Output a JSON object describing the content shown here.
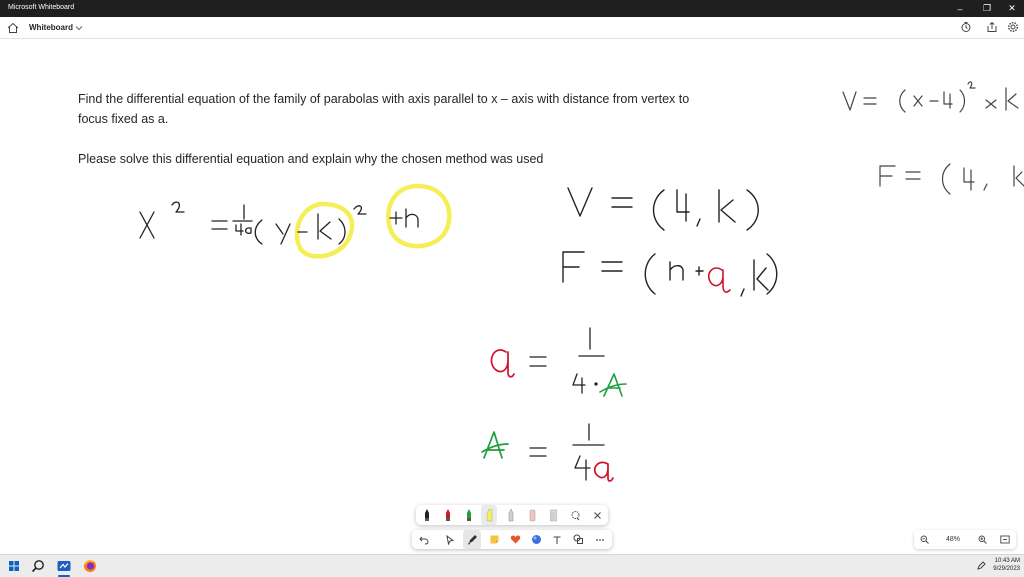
{
  "window": {
    "title": "Microsoft Whiteboard"
  },
  "appbar": {
    "board_title": "Whiteboard"
  },
  "question": {
    "line1": "Find the differential equation of the family of parabolas with axis parallel to x – axis with distance from vertex to",
    "line2": "focus fixed as a.",
    "line3": "Please solve this differential equation and explain why the chosen method was used"
  },
  "zoom": {
    "level": "48%"
  },
  "taskbar": {
    "time": "10:43 AM",
    "date": "9/29/2023"
  },
  "colors": {
    "ink_black": "#222222",
    "ink_red": "#d0112b",
    "ink_green": "#1f9e3c",
    "highlighter": "#f4ef58",
    "titlebar": "#1f1f1f",
    "taskbar": "#ececec"
  },
  "icons": {
    "home": "home-icon",
    "dropdown": "chevron-down-icon",
    "timer": "timer-icon",
    "share": "share-icon",
    "settings": "gear-icon",
    "undo": "undo-icon",
    "select": "select-pointer-icon",
    "pen": "pen-icon",
    "sticky": "sticky-note-icon",
    "reaction": "heart-icon",
    "shapes": "shapes-icon",
    "text": "text-icon",
    "more": "more-icon",
    "lasso": "lasso-icon",
    "close": "close-icon",
    "zoom_out": "zoom-out-icon",
    "zoom_in": "zoom-in-icon",
    "fit": "fit-screen-icon"
  }
}
